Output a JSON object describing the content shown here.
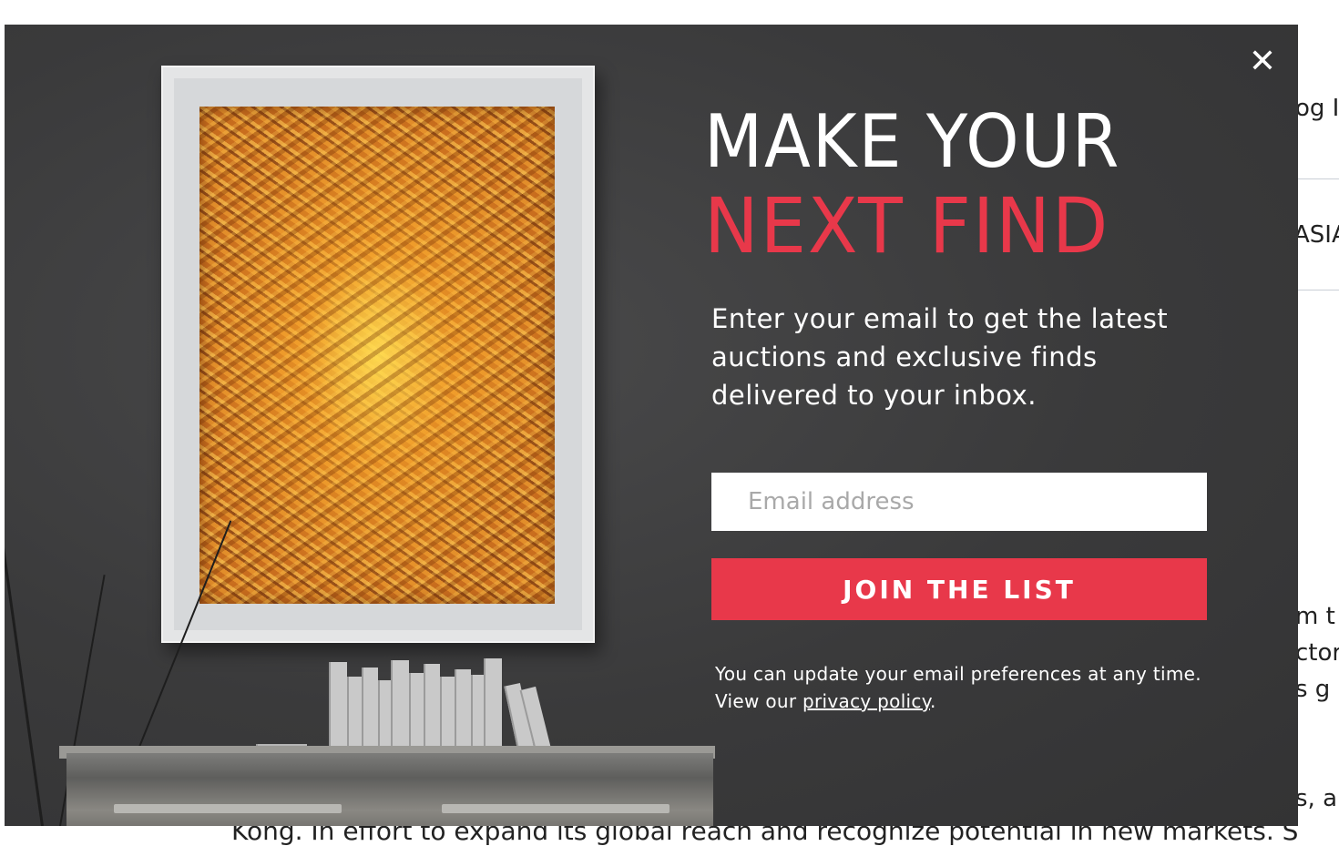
{
  "background_page": {
    "right_fragment_top": "og In",
    "right_fragment_asia": "ASIA",
    "right_fragment_lines": [
      "m t",
      "ctor",
      "s g",
      "s, a"
    ],
    "bottom_text": "Kong. In effort to expand its global reach and recognize potential in new markets. S"
  },
  "modal": {
    "close_glyph": "✕",
    "headline_line1": "MAKE YOUR",
    "headline_line2": "NEXT FIND",
    "intro_text": "Enter your email to get the latest auctions and exclusive finds delivered to your inbox.",
    "email_placeholder": "Email address",
    "email_value": "",
    "join_label": "JOIN THE LIST",
    "note_prefix": "You can update your email preferences at any time. View our ",
    "privacy_link": "privacy policy",
    "note_suffix": "."
  },
  "colors": {
    "modal_bg": "#3b3b3c",
    "accent_red": "#e8384a",
    "text_white": "#ffffff"
  }
}
